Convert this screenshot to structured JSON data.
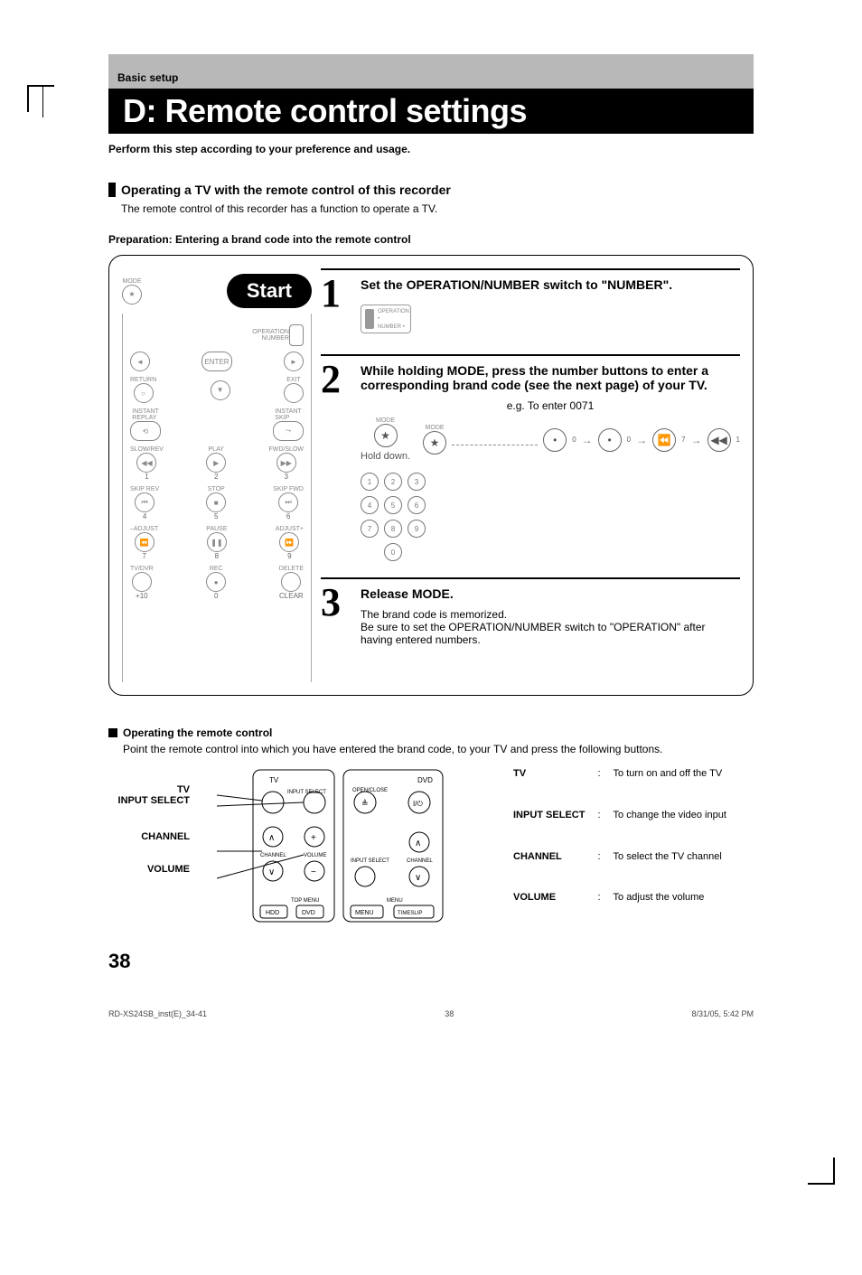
{
  "header": {
    "basic_setup": "Basic setup",
    "title": "D: Remote control settings",
    "intro": "Perform this step according to your preference and usage."
  },
  "section1": {
    "heading": "Operating a TV with the remote control of this recorder",
    "sub": "The remote control of this recorder has a function to operate a TV.",
    "prep": "Preparation: Entering a brand code into the remote control",
    "start": "Start",
    "remote_labels": {
      "mode": "MODE",
      "enter": "ENTER",
      "return": "RETURN",
      "exit": "EXIT",
      "operation": "OPERATION",
      "number": "NUMBER",
      "instant_replay": "INSTANT\nREPLAY",
      "instant_skip": "INSTANT\nSKIP",
      "slow_rev": "SLOW/REV",
      "play": "PLAY",
      "fwd_slow": "FWD/SLOW",
      "skip_rev": "SKIP REV",
      "stop": "STOP",
      "skip_fwd": "SKIP FWD",
      "adjust_minus": "–ADJUST",
      "pause": "PAUSE",
      "adjust_plus": "ADJUST+",
      "tv_dvr": "TV/DVR",
      "rec": "REC",
      "delete": "DELETE",
      "clear": "CLEAR",
      "plus10": "+10",
      "n0": "0",
      "n1": "1",
      "n2": "2",
      "n3": "3",
      "n4": "4",
      "n5": "5",
      "n6": "6",
      "n7": "7",
      "n8": "8",
      "n9": "9"
    },
    "steps": [
      {
        "num": "1",
        "title": "Set the OPERATION/NUMBER switch to \"NUMBER\".",
        "switch_labels": {
          "operation": "OPERATION",
          "number": "NUMBER"
        }
      },
      {
        "num": "2",
        "title": "While holding MODE, press the number buttons to enter a corresponding brand code (see the next page) of your TV.",
        "eg": "e.g. To enter 0071",
        "mode_label": "MODE",
        "hold_down": "Hold down.",
        "digits": [
          "0",
          "0",
          "7",
          "1"
        ]
      },
      {
        "num": "3",
        "title": "Release MODE.",
        "desc1": "The brand code is memorized.",
        "desc2": "Be sure to set the OPERATION/NUMBER switch to \"OPERATION\" after having entered numbers."
      }
    ]
  },
  "section2": {
    "heading": "Operating the remote control",
    "sub": "Point the remote control into which you have entered the brand code, to your TV and press the following buttons.",
    "callouts": [
      "TV",
      "INPUT SELECT",
      "CHANNEL",
      "VOLUME"
    ],
    "diagram_labels": {
      "tv": "TV",
      "dvd": "DVD",
      "input_select": "INPUT SELECT",
      "open_close": "OPEN/CLOSE",
      "channel": "CHANNEL",
      "volume": "VOLUME",
      "input_select2": "INPUT SELECT",
      "channel2": "CHANNEL",
      "top_menu": "TOP MENU",
      "menu": "MENU",
      "hdd": "HDD",
      "dvd2": "DVD",
      "menu_btn": "MENU",
      "timeslip": "TIMESLIP"
    },
    "functions": [
      {
        "k": "TV",
        "v": "To turn on and off the TV"
      },
      {
        "k": "INPUT SELECT",
        "v": "To change the video input"
      },
      {
        "k": "CHANNEL",
        "v": "To select the TV channel"
      },
      {
        "k": "VOLUME",
        "v": "To adjust the volume"
      }
    ]
  },
  "page_number": "38",
  "footer": {
    "left": "RD-XS24SB_inst(E)_34-41",
    "center": "38",
    "right": "8/31/05, 5:42 PM"
  }
}
